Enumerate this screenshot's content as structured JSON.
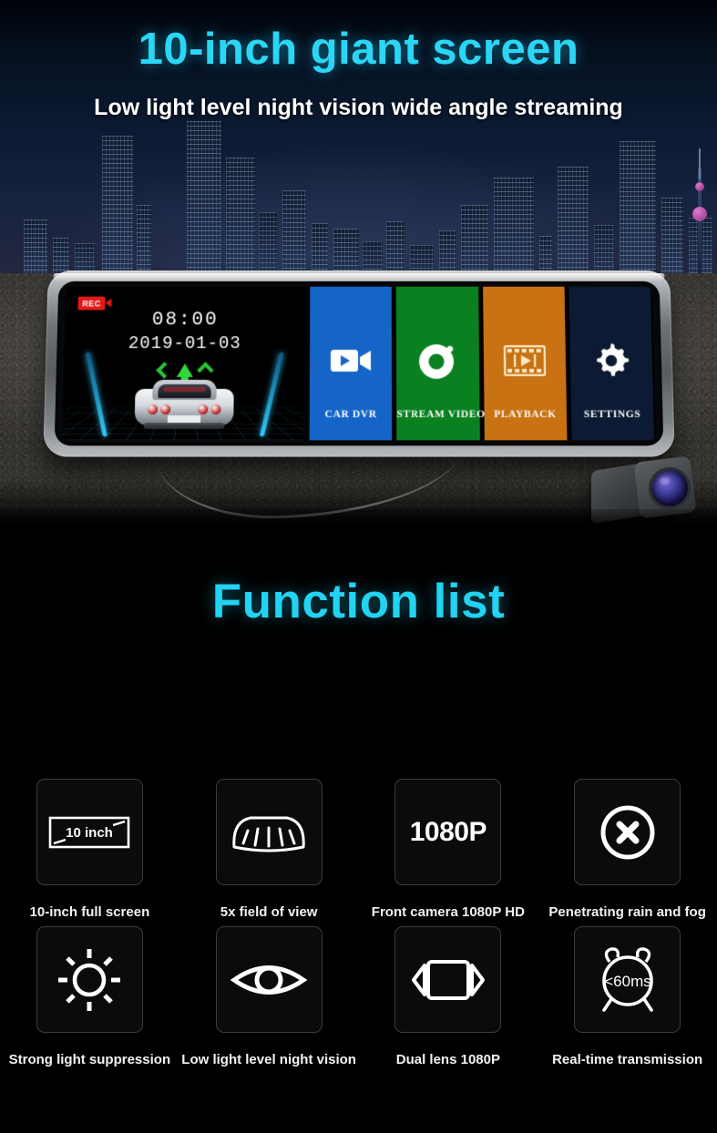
{
  "hero": {
    "title": "10-inch giant screen",
    "subtitle": "Low light level night vision wide angle streaming",
    "accent_color": "#2bd6f5",
    "background": "night-city-skyline-asphalt"
  },
  "device": {
    "type": "rearview-mirror-dashcam",
    "live_view": {
      "rec_label": "REC",
      "rec_color": "#e01818",
      "time": "08:00",
      "date": "2019-01-03",
      "lane_color": "#35c8f5",
      "arrow_color": "#2fd93a",
      "vehicle": "white-sports-car"
    },
    "tiles": [
      {
        "label": "CAR  DVR",
        "icon": "camcorder-icon",
        "bg": "#1565c8",
        "text": "#ffffff"
      },
      {
        "label": "STREAM VIDEO",
        "icon": "camera-lens-icon",
        "bg": "#0a8020",
        "text": "#ffffff"
      },
      {
        "label": "PLAYBACK",
        "icon": "film-strip-icon",
        "bg": "#c87214",
        "text": "#ffffff"
      },
      {
        "label": "SETTINGS",
        "icon": "gear-icon",
        "bg": "#0d1a33",
        "text": "#ffffff"
      }
    ],
    "rear_camera": "rear-camera-module"
  },
  "function_list": {
    "title": "Function list",
    "accent_color": "#22d3f2",
    "items": [
      {
        "label": "10-inch full screen",
        "icon": "screen-size-icon",
        "icon_text": "10 inch"
      },
      {
        "label": "5x field of view",
        "icon": "wide-angle-icon",
        "icon_text": ""
      },
      {
        "label": "Front camera 1080P HD",
        "icon": "resolution-icon",
        "icon_text": "1080P"
      },
      {
        "label": "Penetrating rain and fog",
        "icon": "circle-x-icon",
        "icon_text": ""
      },
      {
        "label": "Strong light suppression",
        "icon": "sun-icon",
        "icon_text": ""
      },
      {
        "label": "Low light level night vision",
        "icon": "eye-icon",
        "icon_text": ""
      },
      {
        "label": "Dual lens 1080P",
        "icon": "dual-lens-icon",
        "icon_text": ""
      },
      {
        "label": "Real-time transmission",
        "icon": "alarm-clock-icon",
        "icon_text": "<60ms"
      }
    ]
  }
}
